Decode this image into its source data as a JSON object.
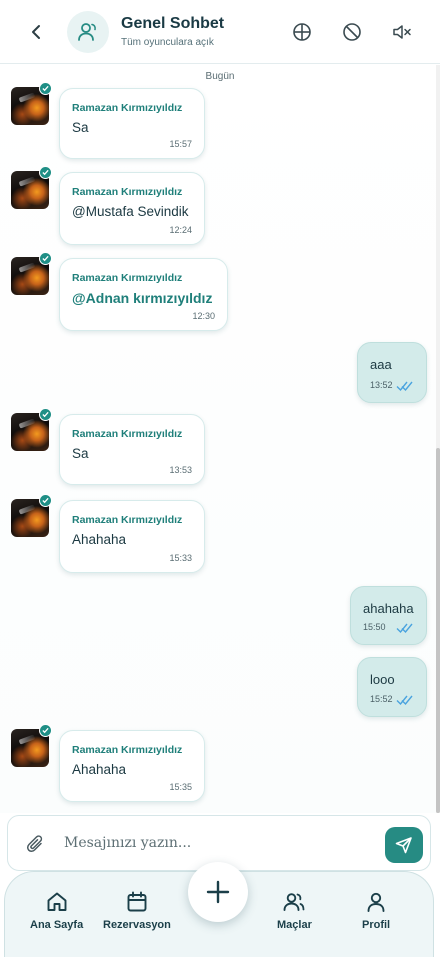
{
  "header": {
    "title": "Genel Sohbet",
    "subtitle": "Tüm oyunculara açık"
  },
  "date_separator": "Bugün",
  "messages": [
    {
      "direction": "incoming",
      "sender": "Ramazan Kırmızıyıldız",
      "text": "Sa",
      "time": "15:57",
      "verified": true
    },
    {
      "direction": "incoming",
      "sender": "Ramazan Kırmızıyıldız",
      "text": "@Mustafa Sevindik",
      "time": "12:24",
      "verified": true
    },
    {
      "direction": "incoming",
      "sender": "Ramazan Kırmızıyıldız",
      "text": "@Adnan kırmızıyıldız",
      "time": "12:30",
      "verified": true,
      "mention": true
    },
    {
      "direction": "outgoing",
      "text": "aaa",
      "time": "13:52",
      "read": true
    },
    {
      "direction": "incoming",
      "sender": "Ramazan Kırmızıyıldız",
      "text": "Sa",
      "time": "13:53",
      "verified": true
    },
    {
      "direction": "incoming",
      "sender": "Ramazan Kırmızıyıldız",
      "text": "Ahahaha",
      "time": "15:33",
      "verified": true
    },
    {
      "direction": "outgoing",
      "text": "ahahaha",
      "time": "15:50",
      "read": true
    },
    {
      "direction": "outgoing",
      "text": "looo",
      "time": "15:52",
      "read": true
    },
    {
      "direction": "incoming",
      "sender": "Ramazan Kırmızıyıldız",
      "text": "Ahahaha",
      "time": "15:35",
      "verified": true
    }
  ],
  "composer": {
    "placeholder": "Mesajınızı yazın...",
    "value": ""
  },
  "nav": {
    "items": [
      {
        "label": "Ana Sayfa",
        "icon": "home-icon"
      },
      {
        "label": "Rezervasyon",
        "icon": "calendar-icon"
      },
      {
        "label": "Maçlar",
        "icon": "users-icon"
      },
      {
        "label": "Profil",
        "icon": "user-icon"
      }
    ],
    "fab_icon": "plus-icon"
  },
  "colors": {
    "accent": "#268b83",
    "sender_name": "#1f7f7a",
    "outgoing_bubble": "#d3ebea",
    "read_ticks": "#4aa3df"
  }
}
